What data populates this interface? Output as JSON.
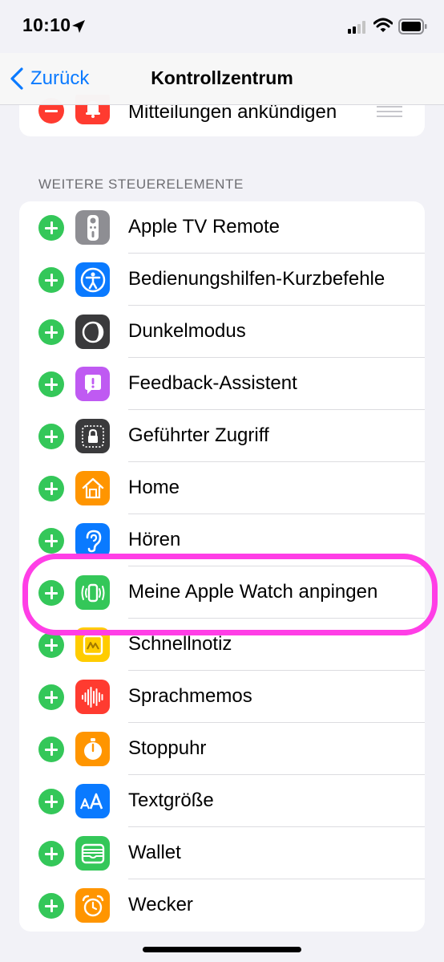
{
  "status_bar": {
    "time": "10:10"
  },
  "nav": {
    "back_label": "Zurück",
    "title": "Kontrollzentrum"
  },
  "included": {
    "items": [
      {
        "label": "Mitteilungen ankündigen",
        "icon": "bell-announce-icon",
        "color": "#ff3b30"
      }
    ]
  },
  "more_controls": {
    "header": "WEITERE STEUERELEMENTE",
    "items": [
      {
        "label": "Apple TV Remote",
        "icon": "tv-remote-icon",
        "color": "#8e8e93"
      },
      {
        "label": "Bedienungshilfen-Kurzbefehle",
        "icon": "accessibility-icon",
        "color": "#0a7aff"
      },
      {
        "label": "Dunkelmodus",
        "icon": "dark-mode-icon",
        "color": "#3a3a3c"
      },
      {
        "label": "Feedback-Assistent",
        "icon": "feedback-icon",
        "color": "#bf5af2"
      },
      {
        "label": "Geführter Zugriff",
        "icon": "lock-icon",
        "color": "#3a3a3c"
      },
      {
        "label": "Home",
        "icon": "home-icon",
        "color": "#ff9500"
      },
      {
        "label": "Hören",
        "icon": "ear-icon",
        "color": "#0a7aff"
      },
      {
        "label": "Meine Apple Watch anpingen",
        "icon": "watch-ping-icon",
        "color": "#34c759"
      },
      {
        "label": "Schnellnotiz",
        "icon": "quick-note-icon",
        "color": "#ffcc00"
      },
      {
        "label": "Sprachmemos",
        "icon": "waveform-icon",
        "color": "#ff3b30"
      },
      {
        "label": "Stoppuhr",
        "icon": "stopwatch-icon",
        "color": "#ff9500"
      },
      {
        "label": "Textgröße",
        "icon": "text-size-icon",
        "color": "#0a7aff"
      },
      {
        "label": "Wallet",
        "icon": "wallet-icon",
        "color": "#34c759"
      },
      {
        "label": "Wecker",
        "icon": "alarm-icon",
        "color": "#ff9500"
      }
    ]
  },
  "colors": {
    "accent": "#0a7aff",
    "add": "#34c759",
    "remove": "#ff3b30",
    "highlight": "#ff3ee6"
  }
}
